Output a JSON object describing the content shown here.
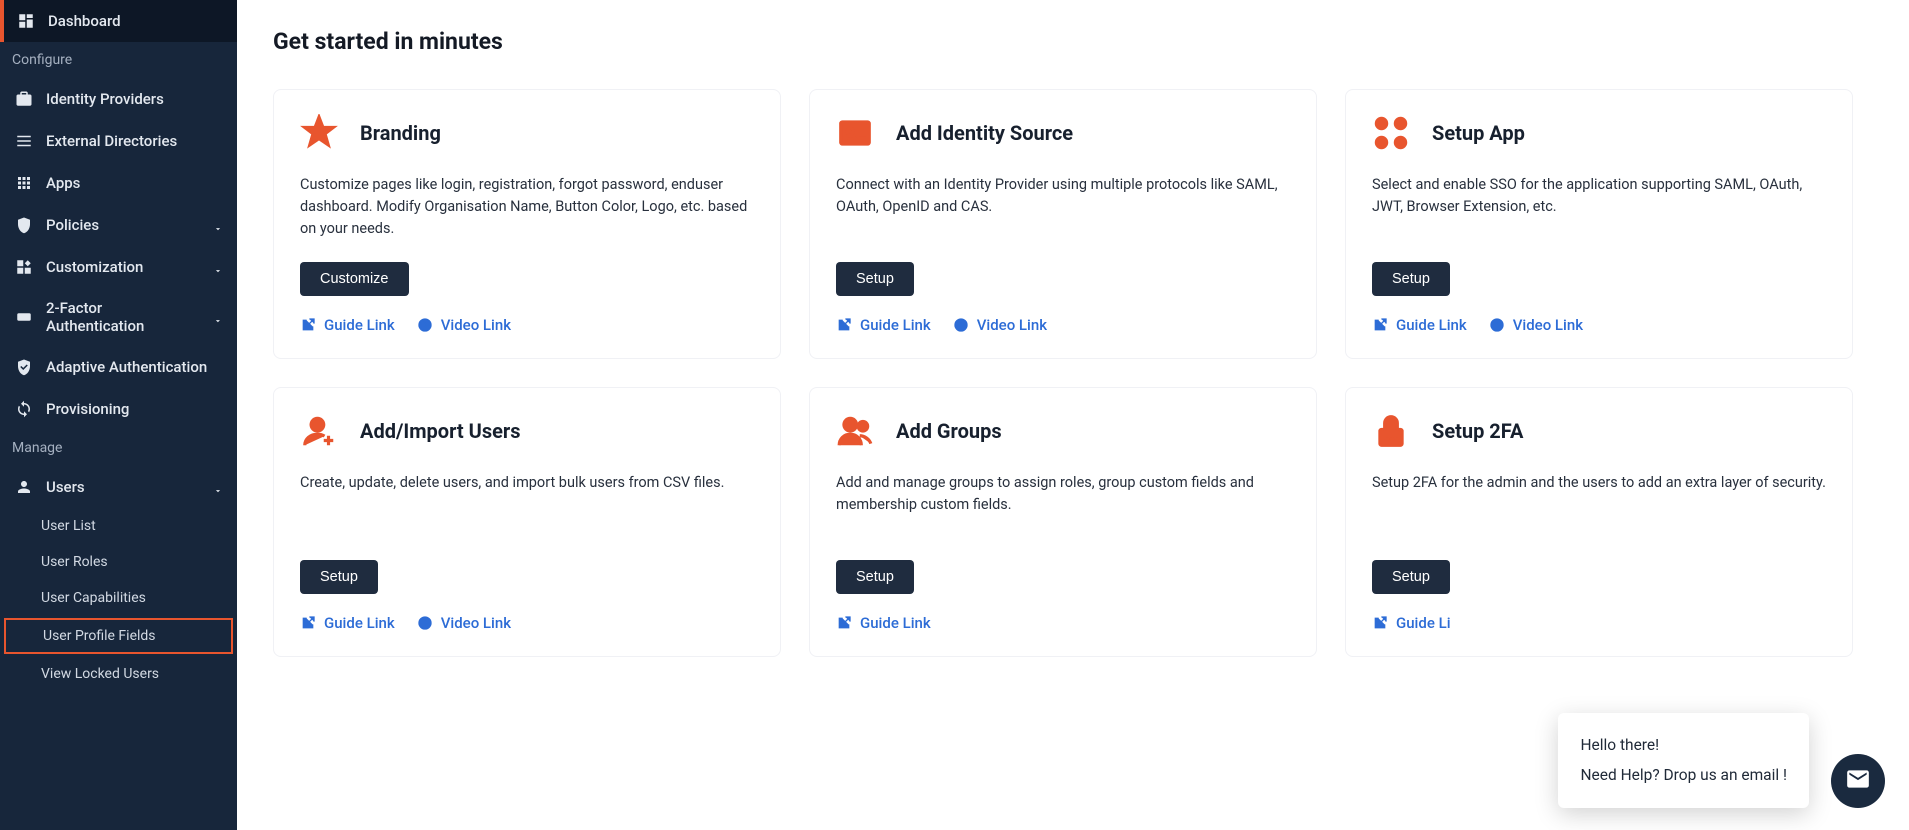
{
  "sidebar": {
    "items": [
      {
        "label": "Dashboard"
      }
    ],
    "section_configure": "Configure",
    "configure": [
      {
        "label": "Identity Providers"
      },
      {
        "label": "External Directories"
      },
      {
        "label": "Apps"
      },
      {
        "label": "Policies"
      },
      {
        "label": "Customization"
      },
      {
        "label": "2-Factor Authentication"
      },
      {
        "label": "Adaptive Authentication"
      },
      {
        "label": "Provisioning"
      }
    ],
    "section_manage": "Manage",
    "manage": [
      {
        "label": "Users"
      }
    ],
    "users_sub": [
      {
        "label": "User List"
      },
      {
        "label": "User Roles"
      },
      {
        "label": "User Capabilities"
      },
      {
        "label": "User Profile Fields"
      },
      {
        "label": "View Locked Users"
      }
    ]
  },
  "page_title": "Get started in minutes",
  "cards": [
    {
      "title": "Branding",
      "desc": "Customize pages like login, registration, forgot password, enduser dashboard. Modify Organisation Name, Button Color, Logo, etc. based on your needs.",
      "btn": "Customize",
      "guide": "Guide Link",
      "video": "Video Link"
    },
    {
      "title": "Add Identity Source",
      "desc": "Connect with an Identity Provider using multiple protocols like SAML, OAuth, OpenID and CAS.",
      "btn": "Setup",
      "guide": "Guide Link",
      "video": "Video Link"
    },
    {
      "title": "Setup App",
      "desc": "Select and enable SSO for the application supporting SAML, OAuth, JWT, Browser Extension, etc.",
      "btn": "Setup",
      "guide": "Guide Link",
      "video": "Video Link"
    },
    {
      "title": "Add/Import Users",
      "desc": "Create, update, delete users, and import bulk users from CSV files.",
      "btn": "Setup",
      "guide": "Guide Link",
      "video": "Video Link"
    },
    {
      "title": "Add Groups",
      "desc": "Add and manage groups to assign roles, group custom fields and membership custom fields.",
      "btn": "Setup",
      "guide": "Guide Link",
      "video": ""
    },
    {
      "title": "Setup 2FA",
      "desc": "Setup 2FA for the admin and the users to add an extra layer of security.",
      "btn": "Setup",
      "guide": "Guide Li",
      "video": ""
    }
  ],
  "chat": {
    "line1": "Hello there!",
    "line2": "Need Help? Drop us an email !"
  }
}
